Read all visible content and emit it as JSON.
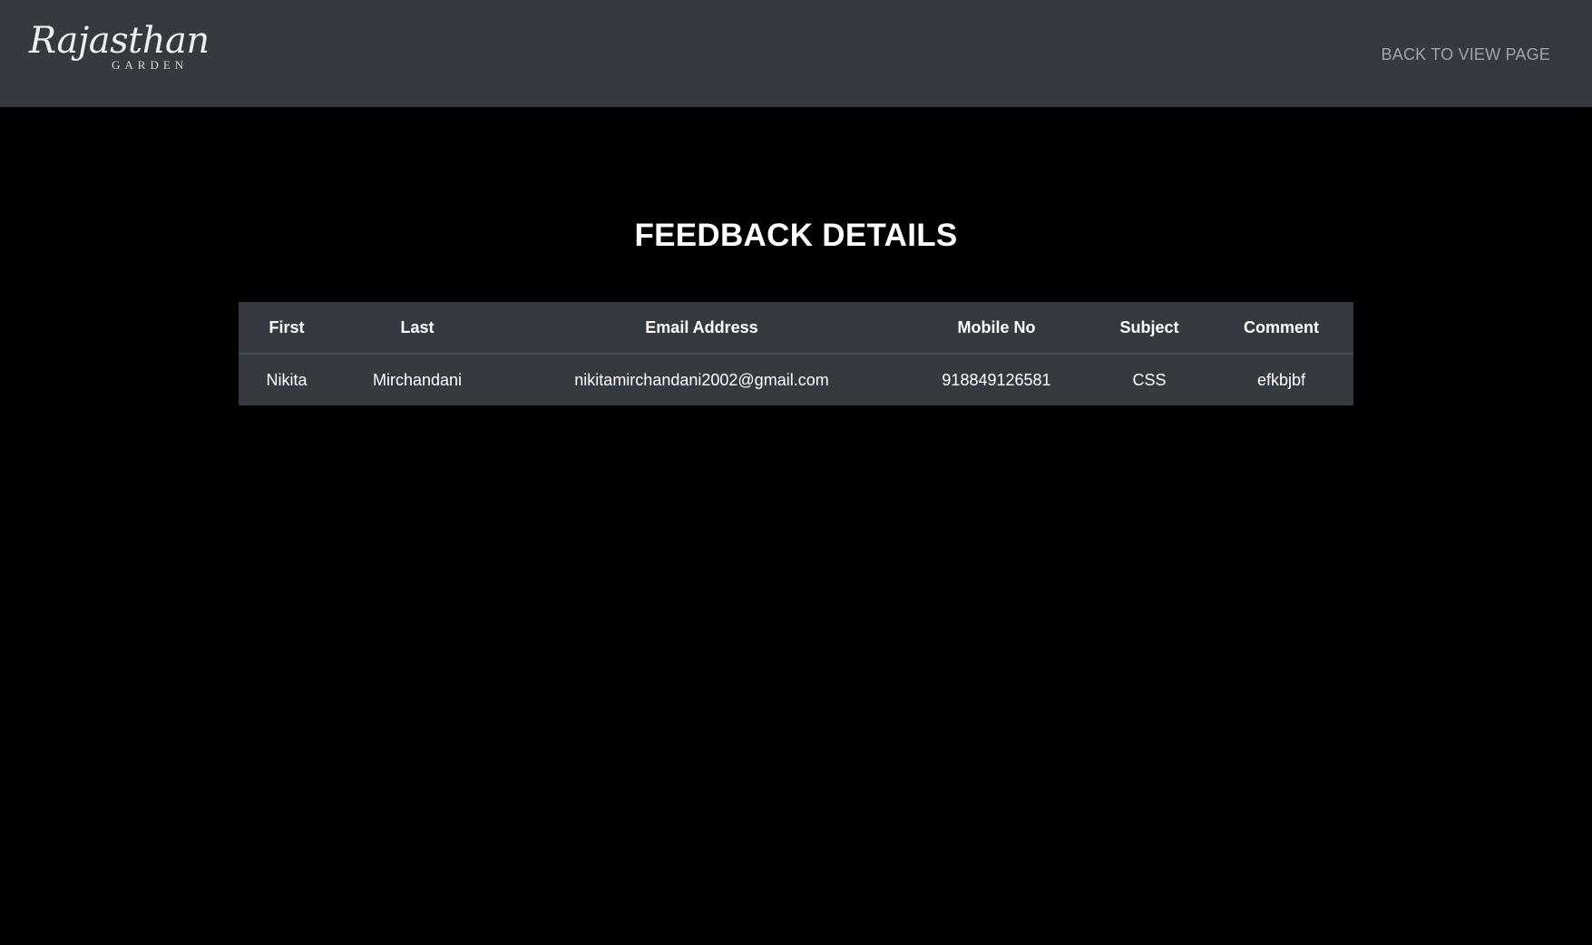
{
  "navbar": {
    "logo": {
      "script": "Rajasthan",
      "sub": "GARDEN"
    },
    "back_link_label": "BACK TO VIEW PAGE"
  },
  "main": {
    "title": "FEEDBACK DETAILS",
    "table": {
      "headers": [
        "First",
        "Last",
        "Email Address",
        "Mobile No",
        "Subject",
        "Comment"
      ],
      "rows": [
        {
          "first": "Nikita",
          "last": "Mirchandani",
          "email": "nikitamirchandani2002@gmail.com",
          "mobile": "918849126581",
          "subject": "CSS",
          "comment": "efkbjbf"
        }
      ]
    }
  },
  "colors": {
    "navbar_bg": "#343a40",
    "page_bg": "#000000",
    "table_bg": "#343a40",
    "link": "#9ea4aa",
    "text": "#ffffff"
  }
}
